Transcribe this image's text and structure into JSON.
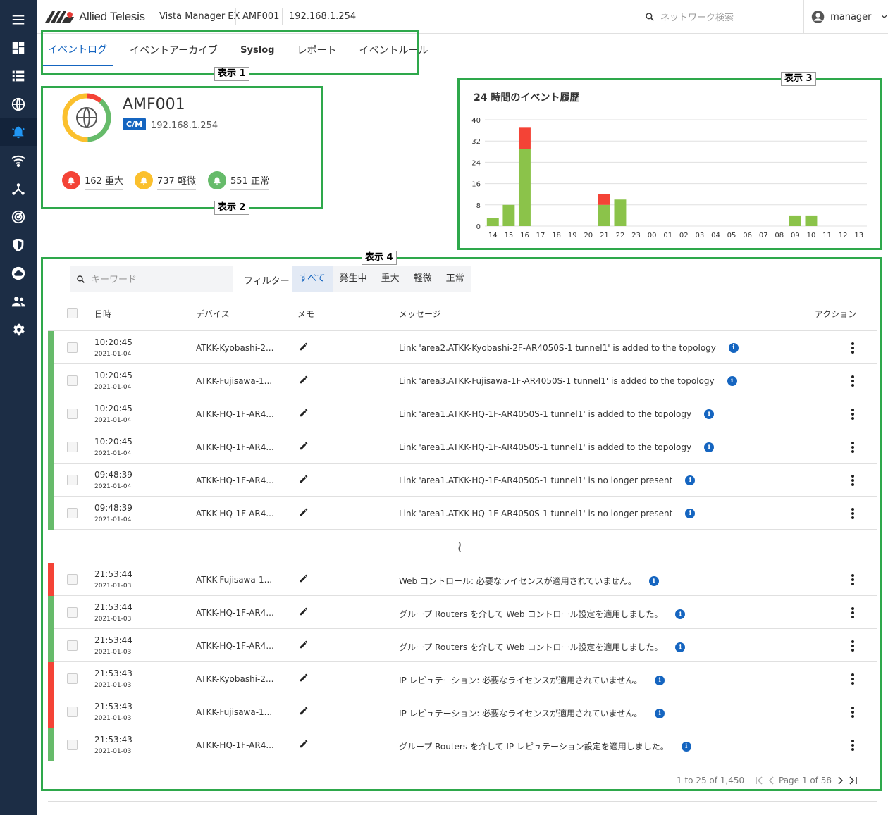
{
  "sidebar": {
    "items": [
      {
        "icon": "menu-icon"
      },
      {
        "icon": "dashboard-icon"
      },
      {
        "icon": "list-icon"
      },
      {
        "icon": "globe-icon"
      },
      {
        "icon": "bell-icon"
      },
      {
        "icon": "wifi-icon"
      },
      {
        "icon": "topology-icon"
      },
      {
        "icon": "radar-icon"
      },
      {
        "icon": "shield-icon"
      },
      {
        "icon": "cloud-icon"
      },
      {
        "icon": "users-icon"
      },
      {
        "icon": "settings-icon"
      }
    ]
  },
  "header": {
    "logo_text": "Allied Telesis",
    "product": "Vista Manager EX",
    "device": "AMF001",
    "ip": "192.168.1.254",
    "search_placeholder": "ネットワーク検索",
    "user": "manager"
  },
  "tabs": [
    {
      "label": "イベントログ",
      "active": true
    },
    {
      "label": "イベントアーカイブ"
    },
    {
      "label": "Syslog"
    },
    {
      "label": "レポート"
    },
    {
      "label": "イベントルール"
    }
  ],
  "annotations": [
    "表示 1",
    "表示 2",
    "表示 3",
    "表示 4"
  ],
  "device_card": {
    "name": "AMF001",
    "badge": "C/M",
    "ip": "192.168.1.254",
    "ring_fractions": {
      "critical": 0.112,
      "minor": 0.508,
      "normal": 0.38
    },
    "stats": [
      {
        "label": "162 重大",
        "color": "#f44336"
      },
      {
        "label": "737 軽微",
        "color": "#fbc02d"
      },
      {
        "label": "551 正常",
        "color": "#66bb6a"
      }
    ]
  },
  "chart_title": "24 時間のイベント履歴",
  "chart_data": {
    "type": "bar",
    "title": "24 時間のイベント履歴",
    "categories": [
      "14",
      "15",
      "16",
      "17",
      "18",
      "19",
      "20",
      "21",
      "22",
      "23",
      "00",
      "01",
      "02",
      "03",
      "04",
      "05",
      "06",
      "07",
      "08",
      "09",
      "10",
      "11",
      "12",
      "13"
    ],
    "series": [
      {
        "color": "#8bc34a",
        "values": [
          3,
          8,
          29,
          0,
          0,
          0,
          0,
          8,
          10,
          0,
          0,
          0,
          0,
          0,
          0,
          0,
          0,
          0,
          0,
          4,
          4,
          0,
          0,
          0
        ]
      },
      {
        "color": "#f44336",
        "values": [
          0,
          0,
          8,
          0,
          0,
          0,
          0,
          4,
          0,
          0,
          0,
          0,
          0,
          0,
          0,
          0,
          0,
          0,
          0,
          0,
          0,
          0,
          0,
          0
        ]
      }
    ],
    "stacked": true,
    "yticks": [
      0,
      8,
      16,
      24,
      32,
      40
    ],
    "ylim": [
      0,
      40
    ],
    "grid": true
  },
  "events": {
    "search_placeholder": "キーワード",
    "filter_label": "フィルター",
    "filters": [
      "すべて",
      "発生中",
      "重大",
      "軽微",
      "正常"
    ],
    "active_filter": 0,
    "columns": {
      "datetime": "日時",
      "device": "デバイス",
      "memo": "メモ",
      "message": "メッセージ",
      "action": "アクション"
    },
    "gap_symbol": "≀",
    "rows": [
      {
        "severity": "#66bb6a",
        "time": "10:20:45",
        "date": "2021-01-04",
        "device": "ATKK-Kyobashi-2...",
        "message": "Link 'area2.ATKK-Kyobashi-2F-AR4050S-1 tunnel1' is added to the topology"
      },
      {
        "severity": "#66bb6a",
        "time": "10:20:45",
        "date": "2021-01-04",
        "device": "ATKK-Fujisawa-1...",
        "message": "Link 'area3.ATKK-Fujisawa-1F-AR4050S-1 tunnel1' is added to the topology"
      },
      {
        "severity": "#66bb6a",
        "time": "10:20:45",
        "date": "2021-01-04",
        "device": "ATKK-HQ-1F-AR4...",
        "message": "Link 'area1.ATKK-HQ-1F-AR4050S-1 tunnel1' is added to the topology"
      },
      {
        "severity": "#66bb6a",
        "time": "10:20:45",
        "date": "2021-01-04",
        "device": "ATKK-HQ-1F-AR4...",
        "message": "Link 'area1.ATKK-HQ-1F-AR4050S-1 tunnel1' is added to the topology"
      },
      {
        "severity": "#66bb6a",
        "time": "09:48:39",
        "date": "2021-01-04",
        "device": "ATKK-HQ-1F-AR4...",
        "message": "Link 'area1.ATKK-HQ-1F-AR4050S-1 tunnel1' is no longer present"
      },
      {
        "severity": "#66bb6a",
        "time": "09:48:39",
        "date": "2021-01-04",
        "device": "ATKK-HQ-1F-AR4...",
        "message": "Link 'area1.ATKK-HQ-1F-AR4050S-1 tunnel1' is no longer present"
      },
      {
        "severity": "#f44336",
        "time": "21:53:44",
        "date": "2021-01-03",
        "device": "ATKK-Fujisawa-1...",
        "message": "Web コントロール: 必要なライセンスが適用されていません。"
      },
      {
        "severity": "#66bb6a",
        "time": "21:53:44",
        "date": "2021-01-03",
        "device": "ATKK-HQ-1F-AR4...",
        "message": "グループ Routers を介して Web コントロール設定を適用しました。"
      },
      {
        "severity": "#66bb6a",
        "time": "21:53:44",
        "date": "2021-01-03",
        "device": "ATKK-HQ-1F-AR4...",
        "message": "グループ Routers を介して Web コントロール設定を適用しました。"
      },
      {
        "severity": "#f44336",
        "time": "21:53:43",
        "date": "2021-01-03",
        "device": "ATKK-Kyobashi-2...",
        "message": "IP レピュテーション: 必要なライセンスが適用されていません。"
      },
      {
        "severity": "#f44336",
        "time": "21:53:43",
        "date": "2021-01-03",
        "device": "ATKK-Fujisawa-1...",
        "message": "IP レピュテーション: 必要なライセンスが適用されていません。"
      },
      {
        "severity": "#66bb6a",
        "time": "21:53:43",
        "date": "2021-01-03",
        "device": "ATKK-HQ-1F-AR4...",
        "message": "グループ Routers を介して IP レピュテーション設定を適用しました。"
      }
    ],
    "range_text": "1 to 25 of 1,450",
    "page_text": "Page 1 of 58"
  }
}
